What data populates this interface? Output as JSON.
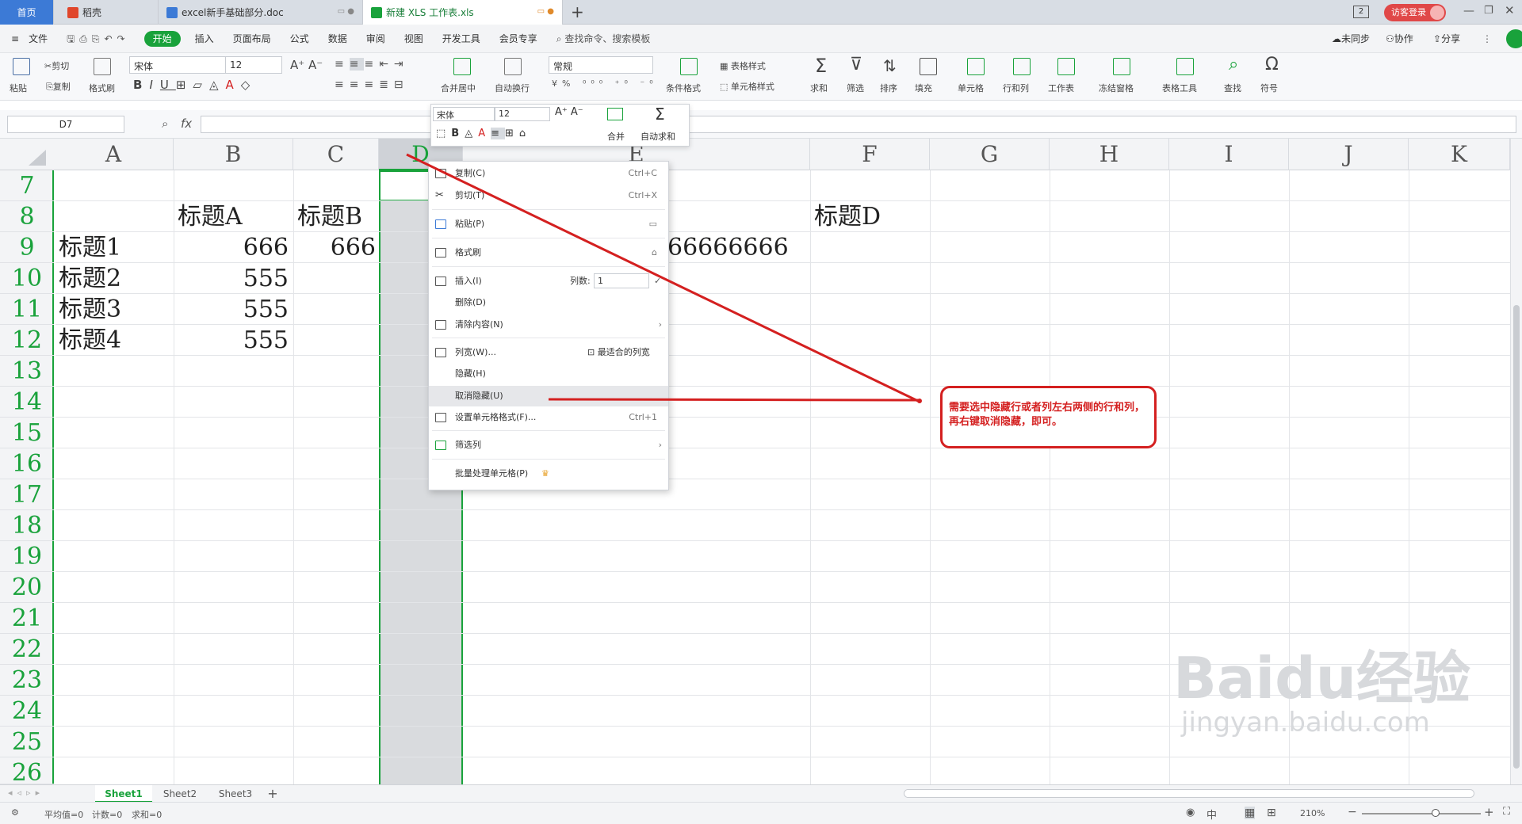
{
  "tabs": {
    "home": "首页",
    "items": [
      {
        "label": "稻壳",
        "color": "#e0462b"
      },
      {
        "label": "excel新手基础部分.doc",
        "color": "#3c7ad6"
      },
      {
        "label": "新建 XLS 工作表.xls",
        "color": "#19a23b"
      }
    ],
    "new_tab": "+",
    "badge_num": "2",
    "login": "访客登录"
  },
  "menubar": {
    "file": "文件",
    "items": [
      "开始",
      "插入",
      "页面布局",
      "公式",
      "数据",
      "审阅",
      "视图",
      "开发工具",
      "会员专享"
    ],
    "active": "开始",
    "search": "查找命令、搜索模板",
    "right": [
      "未同步",
      "协作",
      "分享"
    ]
  },
  "ribbon": {
    "paste": "粘贴",
    "cut": "剪切",
    "copy": "复制",
    "format_painter": "格式刷",
    "font_name": "宋体",
    "font_size": "12",
    "number_format": "常规",
    "merge": "合并居中",
    "wrap": "自动换行",
    "cond_format": "条件格式",
    "table_style": "表格样式",
    "cell_style": "单元格样式",
    "sum": "求和",
    "filter": "筛选",
    "sort": "排序",
    "fill": "填充",
    "cells": "单元格",
    "rowcol": "行和列",
    "sheet": "工作表",
    "freeze": "冻结窗格",
    "tools": "表格工具",
    "find": "查找",
    "symbol": "符号"
  },
  "formula": {
    "namebox": "D7",
    "fx": "fx"
  },
  "columns": [
    "A",
    "B",
    "C",
    "D",
    "E",
    "F",
    "G",
    "H",
    "I",
    "J",
    "K"
  ],
  "rows": [
    "7",
    "8",
    "9",
    "10",
    "11",
    "12",
    "13",
    "14",
    "15",
    "16",
    "17",
    "18",
    "19",
    "20",
    "21",
    "22",
    "23",
    "24",
    "25",
    "26"
  ],
  "cells": {
    "B8": "标题A",
    "C8": "标题B",
    "F8": "标题D",
    "A9": "标题1",
    "B9": "666",
    "C9": "666",
    "E9": "66666666",
    "A10": "标题2",
    "B10": "555",
    "A11": "标题3",
    "B11": "555",
    "A12": "标题4",
    "B12": "555"
  },
  "mini_toolbar": {
    "font": "宋体",
    "size": "12",
    "merge": "合并",
    "autosum": "自动求和"
  },
  "context_menu": {
    "copy": "复制(C)",
    "copy_sc": "Ctrl+C",
    "cut": "剪切(T)",
    "cut_sc": "Ctrl+X",
    "paste": "粘贴(P)",
    "format_painter": "格式刷",
    "insert": "插入(I)",
    "insert_count_label": "列数:",
    "insert_count": "1",
    "delete": "删除(D)",
    "clear": "清除内容(N)",
    "col_width": "列宽(W)...",
    "best_fit": "最适合的列宽",
    "hide": "隐藏(H)",
    "unhide": "取消隐藏(U)",
    "format_cells": "设置单元格格式(F)...",
    "format_cells_sc": "Ctrl+1",
    "filter_col": "筛选列",
    "batch": "批量处理单元格(P)"
  },
  "annotation": "需要选中隐藏行或者列左右两侧的行和列，再右键取消隐藏，即可。",
  "sheets": [
    "Sheet1",
    "Sheet2",
    "Sheet3"
  ],
  "active_sheet": "Sheet1",
  "status": {
    "avg": "平均值=0",
    "count": "计数=0",
    "sum": "求和=0",
    "zoom": "210%"
  },
  "watermark": {
    "brand": "Bai",
    "brand2": "du",
    "cn": "经验",
    "url": "jingyan.baidu.com"
  },
  "colors": {
    "accent": "#19a23b",
    "annotation": "#d42020",
    "home_tab": "#3c7ad6"
  }
}
